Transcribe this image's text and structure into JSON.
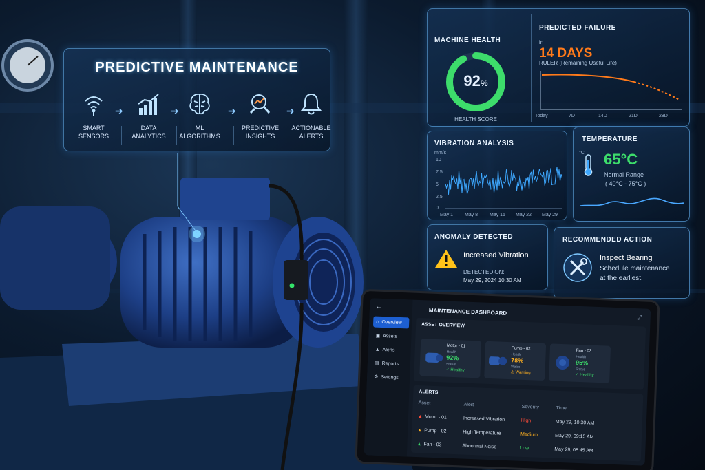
{
  "overview": {
    "title": "PREDICTIVE MAINTENANCE",
    "steps": [
      {
        "line1": "SMART",
        "line2": "SENSORS",
        "icon": "wifi-icon"
      },
      {
        "line1": "DATA",
        "line2": "ANALYTICS",
        "icon": "bar-chart-icon"
      },
      {
        "line1": "ML",
        "line2": "ALGORITHMS",
        "icon": "brain-icon"
      },
      {
        "line1": "PREDICTIVE",
        "line2": "INSIGHTS",
        "icon": "magnifier-chart-icon"
      },
      {
        "line1": "ACTIONABLE",
        "line2": "ALERTS",
        "icon": "bell-icon"
      }
    ]
  },
  "machine_health": {
    "title": "MACHINE HEALTH",
    "value": "92",
    "unit": "%",
    "label": "HEALTH SCORE",
    "score": 0.92,
    "color": "#3ddc6b"
  },
  "predicted_failure": {
    "title": "PREDICTED FAILURE",
    "in": "in",
    "days": "14 DAYS",
    "subtitle": "RULER (Remaining Useful Life)",
    "ticks": [
      "Today",
      "7D",
      "14D",
      "21D",
      "28D"
    ],
    "accent": "#ff7a1a"
  },
  "vibration": {
    "title": "VIBRATION ANALYSIS",
    "unit": "mm/s",
    "yticks": [
      "10",
      "7.5",
      "5",
      "2.5",
      "0"
    ],
    "xticks": [
      "May 1",
      "May 8",
      "May 15",
      "May 22",
      "May 29"
    ]
  },
  "temperature": {
    "title": "TEMPERATURE",
    "value": "65°C",
    "range_label": "Normal Range",
    "range": "( 40°C - 75°C )",
    "unit_icon": "°C"
  },
  "anomaly": {
    "title": "ANOMALY DETECTED",
    "message": "Increased Vibration",
    "detected_label": "DETECTED ON:",
    "detected_at": "May 29, 2024  10:30 AM"
  },
  "action": {
    "title": "RECOMMENDED ACTION",
    "main": "Inspect Bearing",
    "line1": "Schedule maintenance",
    "line2": "at the earliest."
  },
  "dashboard": {
    "title": "MAINTENANCE DASHBOARD",
    "nav": [
      "Overview",
      "Assets",
      "Alerts",
      "Reports",
      "Settings"
    ],
    "asset_overview": "ASSET OVERVIEW",
    "assets": [
      {
        "name": "Motor - 01",
        "health_label": "Health",
        "health": "92%",
        "status_label": "Status",
        "status": "Healthy",
        "color": "#3ddc6b"
      },
      {
        "name": "Pump - 02",
        "health_label": "Health",
        "health": "78%",
        "status_label": "Status",
        "status": "Warning",
        "color": "#ffb020"
      },
      {
        "name": "Fan - 03",
        "health_label": "Health",
        "health": "95%",
        "status_label": "Status",
        "status": "Healthy",
        "color": "#3ddc6b"
      }
    ],
    "alerts_title": "ALERTS",
    "columns": [
      "Asset",
      "Alert",
      "Severity",
      "Time"
    ],
    "alerts": [
      {
        "asset": "Motor - 01",
        "alert": "Increased Vibration",
        "severity": "High",
        "time": "May 29, 10:30 AM",
        "color": "#ff4d3a"
      },
      {
        "asset": "Pump - 02",
        "alert": "High Temperature",
        "severity": "Medium",
        "time": "May 29, 09:15 AM",
        "color": "#ffb020"
      },
      {
        "asset": "Fan - 03",
        "alert": "Abnormal Noise",
        "severity": "Low",
        "time": "May 29, 08:45 AM",
        "color": "#3ddc6b"
      }
    ]
  }
}
